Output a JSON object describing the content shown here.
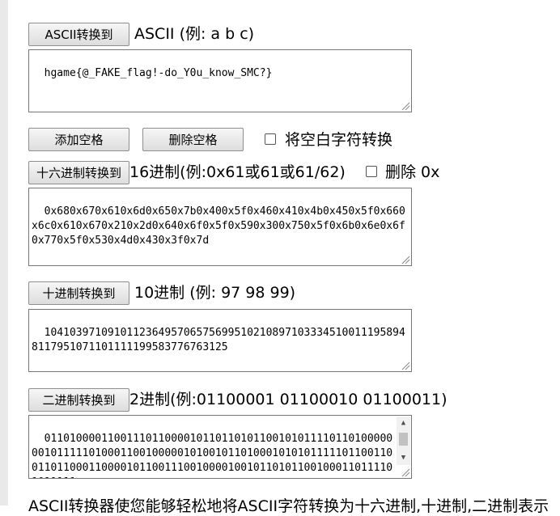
{
  "ascii_section": {
    "button_label": "ASCII转换到",
    "label": "ASCII (例: a b c)",
    "value": "hgame{@_FAKE_flag!-do_Y0u_know_SMC?}"
  },
  "space_controls": {
    "add_space_label": "添加空格",
    "remove_space_label": "删除空格",
    "whitespace_convert_label": "将空白字符转换"
  },
  "hex_section": {
    "button_label": "十六进制转换到",
    "label": "16进制(例:0x61或61或61/62)",
    "remove_0x_label": "删除 0x",
    "value": "0x680x670x610x6d0x650x7b0x400x5f0x460x410x4b0x450x5f0x660x6c0x610x670x210x2d0x640x6f0x5f0x590x300x750x5f0x6b0x6e0x6f0x770x5f0x530x4d0x430x3f0x7d"
  },
  "dec_section": {
    "button_label": "十进制转换到",
    "label": "10进制 (例: 97 98 99)",
    "value": "1041039710910112364957065756995102108971033345100111958948117951071101111199583776763125"
  },
  "bin_section": {
    "button_label": "二进制转换到",
    "label": "2进制(例:01100001 01100010 01100011)",
    "value": "01101000011001110110000101101101011001010111101101000000010111110100011001000001010010110100010101011111011001100110110001100001011001110010000100101101011001000110111101011111"
  },
  "footer": {
    "text": "ASCII转换器使您能够轻松地将ASCII字符转换为十六进制,十进制,二进制表示"
  },
  "icons": {
    "scroll_up": "▲",
    "scroll_down": "▼"
  }
}
